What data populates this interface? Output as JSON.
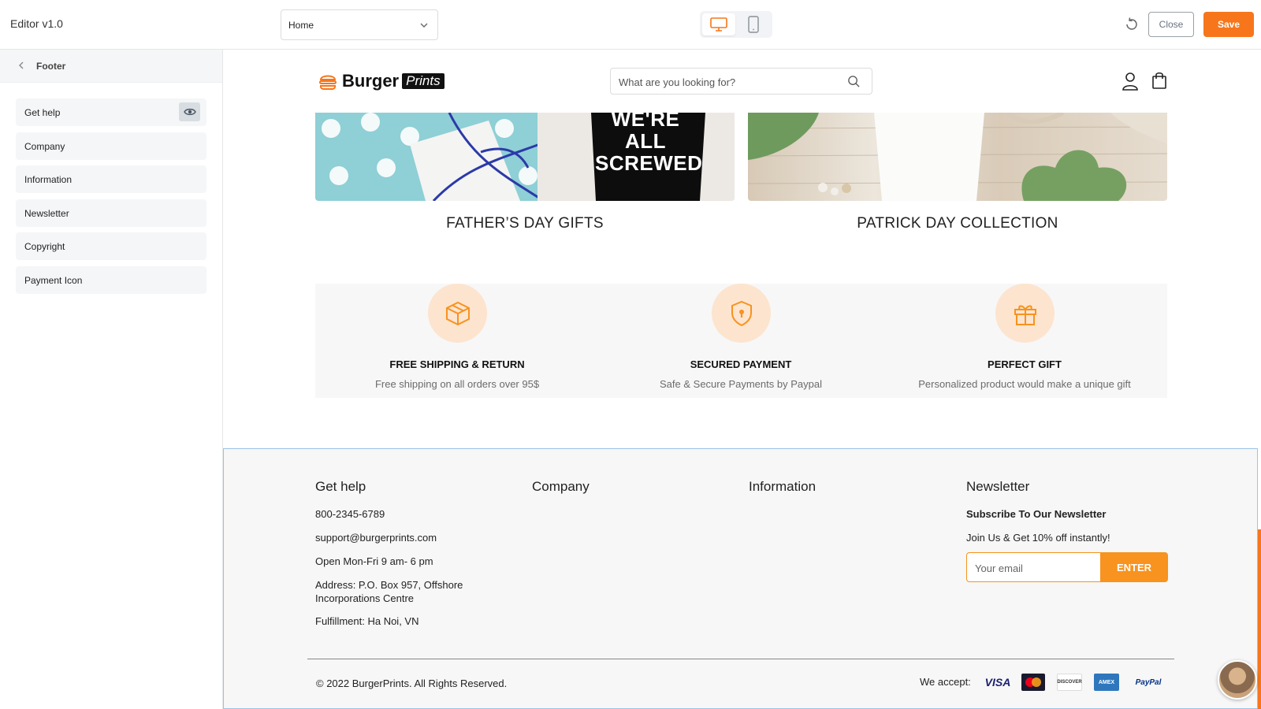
{
  "topbar": {
    "app_title": "Editor v1.0",
    "page_select_value": "Home",
    "close_label": "Close",
    "save_label": "Save"
  },
  "sidebar": {
    "title": "Footer",
    "items": [
      {
        "label": "Get help"
      },
      {
        "label": "Company"
      },
      {
        "label": "Information"
      },
      {
        "label": "Newsletter"
      },
      {
        "label": "Copyright"
      },
      {
        "label": "Payment Icon"
      }
    ]
  },
  "store": {
    "logo_word": "Burger",
    "logo_prints": "Prints",
    "search_placeholder": "What are you looking for?",
    "banners": [
      {
        "title": "FATHER’S DAY GIFTS",
        "image_text": "WE'RE ALL SCREWED"
      },
      {
        "title": "PATRICK DAY COLLECTION"
      }
    ],
    "features": [
      {
        "title": "FREE SHIPPING & RETURN",
        "desc": "Free shipping on all orders over 95$",
        "icon": "box-icon"
      },
      {
        "title": "SECURED PAYMENT",
        "desc": "Safe & Secure Payments by Paypal",
        "icon": "shield-icon"
      },
      {
        "title": "PERFECT GIFT",
        "desc": "Personalized product would make a unique gift",
        "icon": "gift-icon"
      }
    ]
  },
  "footer": {
    "get_help": {
      "title": "Get help",
      "phone": "800-2345-6789",
      "email": "support@burgerprints.com",
      "hours": "Open Mon-Fri 9 am- 6 pm",
      "address_1": "Address: P.O. Box 957, Offshore",
      "address_2": "Incorporations Centre",
      "fulfillment": "Fulfillment: Ha Noi, VN"
    },
    "company": {
      "title": "Company"
    },
    "information": {
      "title": "Information"
    },
    "newsletter": {
      "title": "Newsletter",
      "subtitle": "Subscribe To Our Newsletter",
      "promo": "Join Us & Get 10% off instantly!",
      "email_placeholder": "Your email",
      "enter_label": "ENTER"
    },
    "copyright": "© 2022 BurgerPrints. All Rights Reserved.",
    "we_accept": "We accept:",
    "payments": [
      "VISA",
      "MC",
      "DISCOVER",
      "AMEX",
      "PayPal"
    ]
  },
  "colors": {
    "accent": "#f7761b",
    "newsletter_orange": "#f7931e",
    "feature_circle": "#fde4cf",
    "selection_outline": "#9cc3e6"
  }
}
